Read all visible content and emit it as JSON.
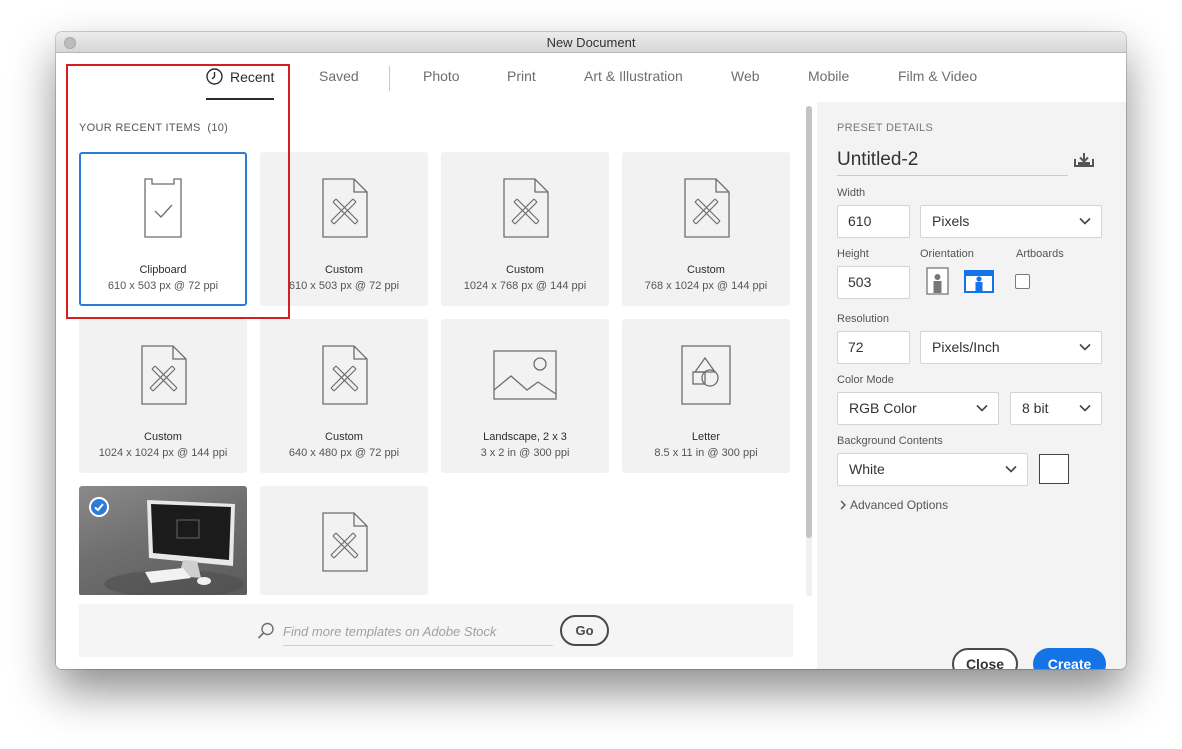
{
  "window": {
    "title": "New Document"
  },
  "tabs": [
    {
      "label": "Recent",
      "active": true
    },
    {
      "label": "Saved"
    },
    {
      "label": "Photo"
    },
    {
      "label": "Print"
    },
    {
      "label": "Art & Illustration"
    },
    {
      "label": "Web"
    },
    {
      "label": "Mobile"
    },
    {
      "label": "Film & Video"
    }
  ],
  "recent": {
    "title": "YOUR RECENT ITEMS",
    "count": "(10)",
    "items": [
      {
        "name": "Clipboard",
        "dims": "610 x 503 px @ 72 ppi",
        "icon": "clipboard-icon",
        "selected": true
      },
      {
        "name": "Custom",
        "dims": "610 x 503 px @ 72 ppi",
        "icon": "custom-document-icon"
      },
      {
        "name": "Custom",
        "dims": "1024 x 768 px @ 144 ppi",
        "icon": "custom-document-icon"
      },
      {
        "name": "Custom",
        "dims": "768 x 1024 px @ 144 ppi",
        "icon": "custom-document-icon"
      },
      {
        "name": "Custom",
        "dims": "1024 x 1024 px @ 144 ppi",
        "icon": "custom-document-icon"
      },
      {
        "name": "Custom",
        "dims": "640 x 480 px @ 72 ppi",
        "icon": "custom-document-icon"
      },
      {
        "name": "Landscape, 2 x 3",
        "dims": "3 x 2 in @ 300 ppi",
        "icon": "landscape-image-icon"
      },
      {
        "name": "Letter",
        "dims": "8.5 x 11 in @ 300 ppi",
        "icon": "letter-shapes-icon"
      },
      {
        "name": "",
        "dims": "",
        "icon": "desktop-photo-thumbnail",
        "checked": true
      },
      {
        "name": "",
        "dims": "",
        "icon": "custom-document-icon"
      }
    ]
  },
  "search": {
    "placeholder": "Find more templates on Adobe Stock",
    "go_label": "Go"
  },
  "preset": {
    "section_title": "PRESET DETAILS",
    "name": "Untitled-2",
    "width_label": "Width",
    "width_value": "610",
    "width_unit": "Pixels",
    "height_label": "Height",
    "height_value": "503",
    "orientation_label": "Orientation",
    "artboards_label": "Artboards",
    "resolution_label": "Resolution",
    "resolution_value": "72",
    "resolution_unit": "Pixels/Inch",
    "color_mode_label": "Color Mode",
    "color_mode": "RGB Color",
    "bit_depth": "8 bit",
    "background_label": "Background Contents",
    "background": "White",
    "advanced_label": "Advanced Options",
    "close_label": "Close",
    "create_label": "Create"
  },
  "colors": {
    "accent": "#1473e6",
    "selection_border": "#2b7bd7",
    "highlight": "#d51f1f",
    "swatch": "#ffffff"
  }
}
